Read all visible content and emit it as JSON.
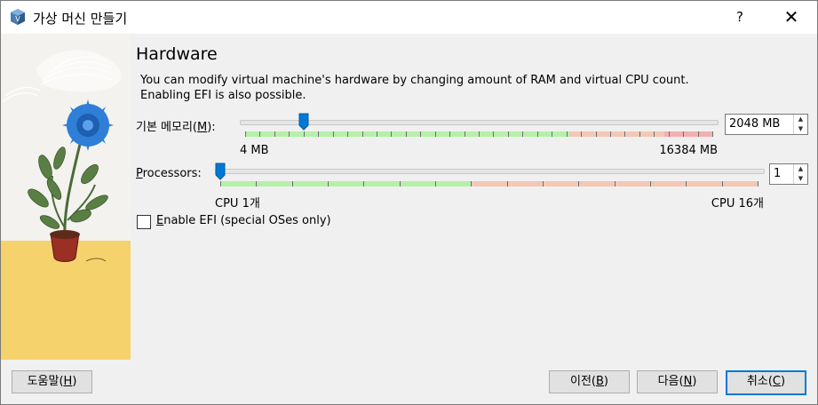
{
  "window": {
    "title": "가상 머신 만들기"
  },
  "titlebar": {
    "help": "?",
    "close": "✕"
  },
  "page": {
    "title": "Hardware",
    "description_lines": [
      "You can modify virtual machine's hardware by changing amount of RAM and virtual CPU count.",
      "Enabling EFI is also possible."
    ]
  },
  "memory": {
    "label_prefix": "기본 메모리(",
    "label_mnemonic": "M",
    "label_suffix": "):",
    "value": "2048 MB",
    "min_label": "4 MB",
    "max_label": "16384 MB",
    "level_fraction": 0.125
  },
  "processors": {
    "label_mnemonic": "P",
    "label_rest": "rocessors:",
    "value": "1",
    "min_label": "CPU 1개",
    "max_label": "CPU 16개",
    "level_fraction": 0.0
  },
  "efi": {
    "label_mnemonic": "E",
    "label_rest": "nable EFI (special OSes only)",
    "checked": false
  },
  "footer": {
    "help": {
      "prefix": "도움말(",
      "mnemonic": "H",
      "suffix": ")"
    },
    "back": {
      "prefix": "이전(",
      "mnemonic": "B",
      "suffix": ")"
    },
    "next": {
      "prefix": "다음(",
      "mnemonic": "N",
      "suffix": ")"
    },
    "cancel": {
      "prefix": "취소(",
      "mnemonic": "C",
      "suffix": ")"
    }
  },
  "colors": {
    "ok_green": "#b6f0a8",
    "warn_orange": "#f3c8b6",
    "bad_red": "#f2b0b0",
    "accent_blue": "#0078d7",
    "art_yellow": "#f5d26c",
    "flower_blue": "#2f7fd8"
  },
  "icons": {
    "app": "virtualbox-cube-icon",
    "help": "question-mark-icon",
    "close": "close-icon",
    "spin_up": "caret-up-icon",
    "spin_down": "caret-down-icon"
  }
}
